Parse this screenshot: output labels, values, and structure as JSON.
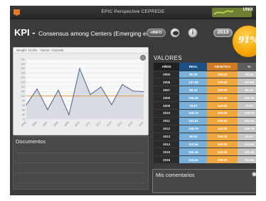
{
  "app": {
    "title": "EPIC Perspective CEPREDE",
    "brand": "UNIX"
  },
  "header": {
    "kpi": "KPI -",
    "description": "Consensus among Centers (Emerging ec.)",
    "info_button": "+INFO",
    "info_circle": "i",
    "year": "2013",
    "gauge_value": "91%"
  },
  "chart_meta": {
    "weight": "Weight: 10.0%",
    "owner": "Owner: Ceprede"
  },
  "chart_data": {
    "type": "line",
    "x": [
      "2005",
      "2006",
      "2007",
      "2008",
      "2009",
      "2010",
      "2011",
      "2012",
      "2013",
      "2014",
      "2015",
      "2016"
    ],
    "series": [
      {
        "values": [
          90.35,
          107.6,
          85.22,
          106.35,
          79.57,
          129.79,
          101.61,
          109.79,
          90.63,
          112.54,
          105.46,
          104.64
        ]
      },
      {
        "values": [
          100,
          100,
          100,
          100,
          100,
          100,
          100,
          100,
          100,
          100,
          100,
          100
        ]
      }
    ],
    "ylim": [
      75,
      140
    ],
    "yticks": [
      140,
      135,
      130,
      125,
      120,
      115,
      110,
      105,
      100,
      95,
      90,
      85,
      80,
      75
    ],
    "colors": {
      "real": "#566f92",
      "objective": "#e58c2a",
      "fill": "#c8cdd5"
    }
  },
  "documents": {
    "title": "Documentos"
  },
  "values": {
    "title": "VALORES",
    "headers": [
      "AÑOS",
      "REAL",
      "OBJETIVO",
      "%"
    ],
    "rows": [
      [
        "2005",
        "90.35",
        "100.00",
        "90.35"
      ],
      [
        "2006",
        "107.60",
        "100.00",
        "107.60"
      ],
      [
        "2007",
        "85.22",
        "100.00",
        "85.22"
      ],
      [
        "2008",
        "106.35",
        "100.00",
        "106.35"
      ],
      [
        "2009",
        "79.57",
        "100.00",
        "79.57"
      ],
      [
        "2010",
        "129.79",
        "100.00",
        "129.79"
      ],
      [
        "2011",
        "101.61",
        "100.00",
        "101.61"
      ],
      [
        "2012",
        "109.79",
        "100.00",
        "109.79"
      ],
      [
        "2013",
        "90.63",
        "100.00",
        "90.63"
      ],
      [
        "2014",
        "112.54",
        "100.00",
        "112.54"
      ],
      [
        "2015",
        "105.46",
        "100.00",
        "105.46"
      ],
      [
        "2016",
        "104.64",
        "100.00",
        "104.64"
      ]
    ]
  },
  "comments": {
    "title": "Mis comentarios"
  }
}
